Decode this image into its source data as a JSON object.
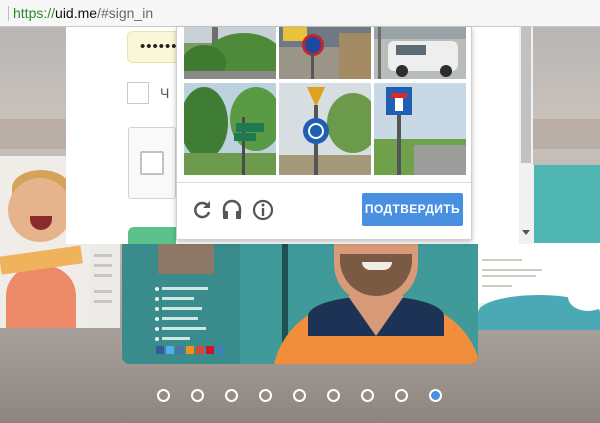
{
  "browser": {
    "url_scheme": "https://",
    "url_host": "uid.me",
    "url_rest": "/#sign_in"
  },
  "login": {
    "password_value": "••••••",
    "remember_label": "Ч"
  },
  "recaptcha": {
    "tiles": [
      "hedge",
      "road-sign",
      "white-car",
      "trees-street-sign",
      "roundabout-sign",
      "no-through-road-sign"
    ],
    "icons": [
      "reload-icon",
      "audio-headphones-icon",
      "info-icon"
    ],
    "verify_label": "ПОДТВЕРДИТЬ",
    "accent": "#4a90e2"
  },
  "carousel": {
    "dot_count": 9,
    "active_index": 8
  }
}
